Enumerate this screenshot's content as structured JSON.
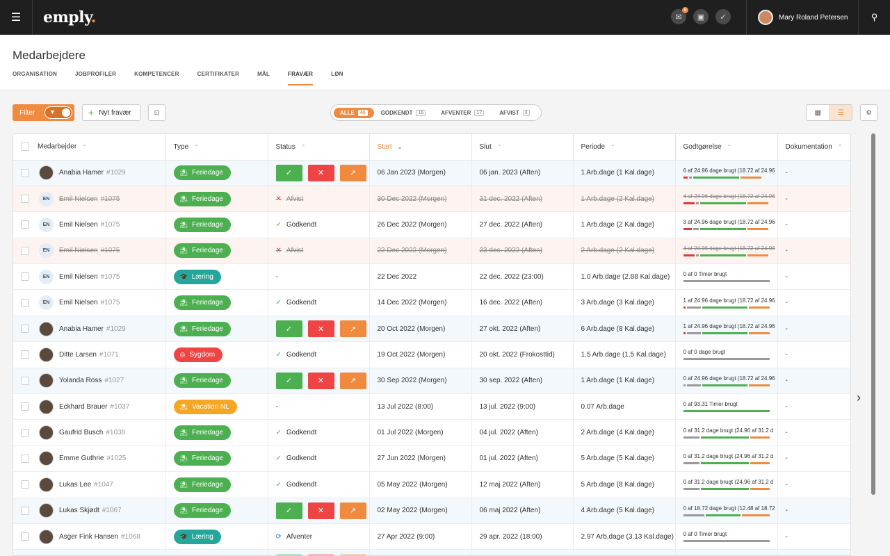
{
  "header": {
    "logo": "emply",
    "logo_dot": ".",
    "notification_count": "6",
    "user_name": "Mary Roland Petersen",
    "icons": [
      "menu-icon",
      "mail-icon",
      "calendar-icon",
      "check-icon",
      "search-icon"
    ]
  },
  "page": {
    "title": "Medarbejdere",
    "tabs": [
      {
        "label": "ORGANISATION"
      },
      {
        "label": "JOBPROFILER"
      },
      {
        "label": "KOMPETENCER"
      },
      {
        "label": "CERTIFIKATER"
      },
      {
        "label": "MÅL"
      },
      {
        "label": "FRAVÆR",
        "active": true
      },
      {
        "label": "LØN"
      }
    ]
  },
  "toolbar": {
    "filter_label": "Filter",
    "new_label": "Nyt fravær",
    "segments": [
      {
        "label": "ALLE",
        "count": "40",
        "active": true
      },
      {
        "label": "GODKENDT",
        "count": "15"
      },
      {
        "label": "AFVENTER",
        "count": "17"
      },
      {
        "label": "AFVIST",
        "count": "3"
      }
    ]
  },
  "table": {
    "columns": [
      "Medarbejder",
      "Type",
      "Status",
      "Start",
      "Slut",
      "Periode",
      "Godtgørelse",
      "Dokumentation"
    ],
    "sorted_column": "Start",
    "rows": [
      {
        "name": "Anabia Hamer",
        "id": "#1029",
        "avatar": "photo",
        "type": "Feriedage",
        "status": "actions",
        "start": "06 Jan 2023 (Morgen)",
        "end": "06 jan. 2023 (Aften)",
        "period": "1 Arb.dage (1 Kal.dage)",
        "comp": "6 af 24.96 dage brugt (18.72 af 24.96",
        "doc": "-",
        "row": "approvable",
        "bar": [
          [
            6,
            "#e53935"
          ],
          [
            4,
            "#999"
          ],
          [
            66,
            "#4caf50"
          ],
          [
            30,
            "#f08a3e"
          ]
        ]
      },
      {
        "name": "Emil Nielsen",
        "id": "#1075",
        "avatar": "EN",
        "type": "Feriedage",
        "status": "Afvist",
        "start": "30 Dec 2022 (Morgen)",
        "end": "31 dec. 2022 (Aften)",
        "period": "1 Arb.dage (2 Kal.dage)",
        "comp": "4 af 24.96 dage brugt (18.72 af 24.96",
        "doc": "-",
        "row": "rejected",
        "bar": [
          [
            16,
            "#e53935"
          ],
          [
            4,
            "#999"
          ],
          [
            66,
            "#4caf50"
          ],
          [
            30,
            "#f08a3e"
          ]
        ]
      },
      {
        "name": "Emil Nielsen",
        "id": "#1075",
        "avatar": "EN",
        "type": "Feriedage",
        "status": "Godkendt",
        "start": "26 Dec 2022 (Morgen)",
        "end": "27 dec. 2022 (Aften)",
        "period": "1 Arb.dage (2 Kal.dage)",
        "comp": "3 af 24.96 dage brugt (18.72 af 24.96",
        "doc": "-",
        "row": "",
        "bar": [
          [
            12,
            "#e53935"
          ],
          [
            8,
            "#999"
          ],
          [
            66,
            "#4caf50"
          ],
          [
            30,
            "#f08a3e"
          ]
        ]
      },
      {
        "name": "Emil Nielsen",
        "id": "#1075",
        "avatar": "EN",
        "type": "Feriedage",
        "status": "Afvist",
        "start": "22 Dec 2022 (Morgen)",
        "end": "23 dec. 2022 (Aften)",
        "period": "2 Arb.dage (2 Kal.dage)",
        "comp": "4 af 24.96 dage brugt (18.72 af 24.96",
        "doc": "-",
        "row": "rejected",
        "bar": [
          [
            16,
            "#e53935"
          ],
          [
            4,
            "#999"
          ],
          [
            66,
            "#4caf50"
          ],
          [
            30,
            "#f08a3e"
          ]
        ]
      },
      {
        "name": "Emil Nielsen",
        "id": "#1075",
        "avatar": "EN",
        "type": "Læring",
        "status": "-",
        "start": "22 Dec 2022",
        "end": "22 dec. 2022 (23:00)",
        "period": "1.0 Arb.dage (2.88 Kal.dage)",
        "comp": "0 af 0 Timer brugt",
        "doc": "-",
        "row": "",
        "bar": [
          [
            124,
            "#999"
          ]
        ]
      },
      {
        "name": "Emil Nielsen",
        "id": "#1075",
        "avatar": "EN",
        "type": "Feriedage",
        "status": "Godkendt",
        "start": "14 Dec 2022 (Morgen)",
        "end": "16 dec. 2022 (Aften)",
        "period": "3 Arb.dage (3 Kal.dage)",
        "comp": "1 af 24.96 dage brugt (18.72 af 24.96",
        "doc": "-",
        "row": "",
        "bar": [
          [
            4,
            "#e53935"
          ],
          [
            20,
            "#999"
          ],
          [
            66,
            "#4caf50"
          ],
          [
            30,
            "#f08a3e"
          ]
        ]
      },
      {
        "name": "Anabia Hamer",
        "id": "#1029",
        "avatar": "photo",
        "type": "Feriedage",
        "status": "actions",
        "start": "20 Oct 2022 (Morgen)",
        "end": "27 okt. 2022 (Aften)",
        "period": "6 Arb.dage (8 Kal.dage)",
        "comp": "1 af 24.96 dage brugt (18.72 af 24.96",
        "doc": "-",
        "row": "approvable",
        "bar": [
          [
            4,
            "#e53935"
          ],
          [
            20,
            "#999"
          ],
          [
            66,
            "#4caf50"
          ],
          [
            30,
            "#f08a3e"
          ]
        ]
      },
      {
        "name": "Ditte Larsen",
        "id": "#1071",
        "avatar": "photo",
        "type": "Sygdom",
        "status": "Godkendt",
        "start": "19 Oct 2022 (Morgen)",
        "end": "20 okt. 2022 (Frokosttid)",
        "period": "1.5 Arb.dage (1.5 Kal.dage)",
        "comp": "0 af 0 dage brugt",
        "doc": "-",
        "row": "",
        "bar": [
          [
            124,
            "#999"
          ]
        ]
      },
      {
        "name": "Yolanda Ross",
        "id": "#1027",
        "avatar": "photo",
        "type": "Feriedage",
        "status": "actions",
        "start": "30 Sep 2022 (Morgen)",
        "end": "30 sep. 2022 (Aften)",
        "period": "1 Arb.dage (1 Kal.dage)",
        "comp": "0 af 24.96 dage brugt (18.72 af 24.96",
        "doc": "-",
        "row": "approvable",
        "bar": [
          [
            4,
            "#999"
          ],
          [
            20,
            "#999"
          ],
          [
            66,
            "#4caf50"
          ],
          [
            30,
            "#f08a3e"
          ]
        ]
      },
      {
        "name": "Eckhard Brauer",
        "id": "#1037",
        "avatar": "photo",
        "type": "Vacation NL",
        "status": "-",
        "start": "13 Jul 2022 (8:00)",
        "end": "13 jul. 2022 (9:00)",
        "period": "0.07 Arb.dage",
        "comp": "0 af 93.31 Timer brugt",
        "doc": "-",
        "row": "",
        "bar": [
          [
            124,
            "#4caf50"
          ]
        ]
      },
      {
        "name": "Gaufrid Busch",
        "id": "#1038",
        "avatar": "photo",
        "type": "Feriedage",
        "status": "Godkendt",
        "start": "01 Jul 2022 (Morgen)",
        "end": "04 jul. 2022 (Aften)",
        "period": "2 Arb.dage (4 Kal.dage)",
        "comp": "0 af 31.2 dage brugt (24.96 af 31.2 d",
        "doc": "-",
        "row": "",
        "bar": [
          [
            24,
            "#999"
          ],
          [
            70,
            "#4caf50"
          ],
          [
            28,
            "#f08a3e"
          ]
        ]
      },
      {
        "name": "Emme Guthrie",
        "id": "#1025",
        "avatar": "photo",
        "type": "Feriedage",
        "status": "Godkendt",
        "start": "27 Jun 2022 (Morgen)",
        "end": "01 jul. 2022 (Aften)",
        "period": "5 Arb.dage (5 Kal.dage)",
        "comp": "0 af 31.2 dage brugt (24.96 af 31.2 d",
        "doc": "-",
        "row": "",
        "bar": [
          [
            24,
            "#999"
          ],
          [
            70,
            "#4caf50"
          ],
          [
            28,
            "#f08a3e"
          ]
        ]
      },
      {
        "name": "Lukas Lee",
        "id": "#1047",
        "avatar": "photo",
        "type": "Feriedage",
        "status": "Godkendt",
        "start": "05 May 2022 (Morgen)",
        "end": "12 maj 2022 (Aften)",
        "period": "5 Arb.dage (8 Kal.dage)",
        "comp": "0 af 31.2 dage brugt (24.96 af 31.2 d",
        "doc": "-",
        "row": "",
        "bar": [
          [
            24,
            "#999"
          ],
          [
            70,
            "#4caf50"
          ],
          [
            28,
            "#f08a3e"
          ]
        ]
      },
      {
        "name": "Lukas Skjødt",
        "id": "#1067",
        "avatar": "photo",
        "type": "Feriedage",
        "status": "actions",
        "start": "02 May 2022 (Morgen)",
        "end": "06 maj 2022 (Aften)",
        "period": "4 Arb.dage (5 Kal.dage)",
        "comp": "0 af 18.72 dage brugt (12.48 af 18.72",
        "doc": "-",
        "row": "approvable",
        "bar": [
          [
            30,
            "#999"
          ],
          [
            50,
            "#4caf50"
          ],
          [
            40,
            "#f08a3e"
          ]
        ]
      },
      {
        "name": "Asger Fink Hansen",
        "id": "#1068",
        "avatar": "photo",
        "type": "Læring",
        "status": "Afventer",
        "start": "27 Apr 2022 (9:00)",
        "end": "29 apr. 2022 (18:00)",
        "period": "2.97 Arb.dage (3.13 Kal.dage)",
        "comp": "0 af 0 Timer brugt",
        "doc": "-",
        "row": "",
        "bar": [
          [
            124,
            "#999"
          ]
        ]
      },
      {
        "name": "",
        "id": "",
        "avatar": "none",
        "type": "Sygdom",
        "status": "actions",
        "start": "",
        "end": "",
        "period": "",
        "comp": "",
        "doc": "",
        "row": "approvable",
        "bar": []
      }
    ]
  },
  "colors": {
    "accent": "#f08a3e",
    "feriedage": "#4caf50",
    "laering": "#26a69a",
    "sygdom": "#ef4444",
    "vacation": "#f5a623"
  }
}
